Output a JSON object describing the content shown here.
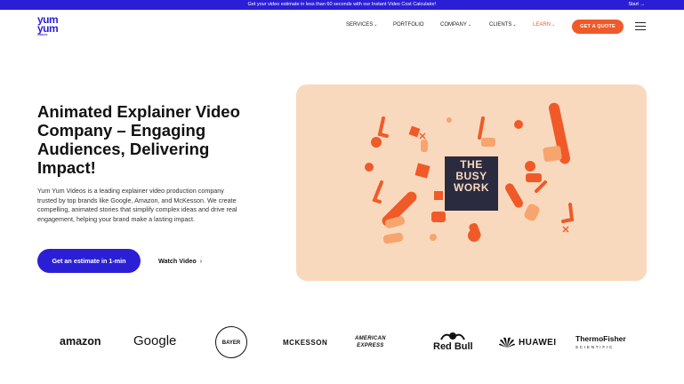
{
  "topbar": {
    "message": "Get your video estimate in less than 60 seconds with our Instant Video Cost Calculator!",
    "start_label": "Start →"
  },
  "header": {
    "logo": {
      "line1": "yum",
      "line2": "yum",
      "tagline": "VIDEOS"
    },
    "nav": [
      {
        "label": "SERVICES",
        "has_dropdown": true
      },
      {
        "label": "PORTFOLIO",
        "has_dropdown": false
      },
      {
        "label": "COMPANY",
        "has_dropdown": true
      },
      {
        "label": "CLIENTS",
        "has_dropdown": true
      },
      {
        "label": "LEARN",
        "has_dropdown": true
      }
    ],
    "quote_button": "GET A QUOTE",
    "menu_icon": "hamburger-menu-icon"
  },
  "hero": {
    "title": "Animated Explainer Video Company – Engaging Audiences, Delivering Impact!",
    "description": "Yum Yum Videos is a leading explainer video production company trusted by top brands like Google, Amazon, and McKesson. We create compelling, animated stories that simplify complex ideas and drive real engagement, helping your brand make a lasting impact.",
    "cta_button": "Get an estimate in 1-min",
    "watch_link": "Watch Video",
    "art": {
      "line1": "THE",
      "line2": "BUSY",
      "line3": "WORK",
      "background_color": "#f9d9bd",
      "accent_color": "#f05a28"
    }
  },
  "clients": {
    "amazon": "amazon",
    "google": "Google",
    "bayer": "BAYER",
    "mckesson": "MCKESSON",
    "amex_line1": "AMERICAN",
    "amex_line2": "EXPRESS",
    "redbull": "Red Bull",
    "huawei": "HUAWEI",
    "thermo_line1": "ThermoFisher",
    "thermo_line2": "SCIENTIFIC"
  },
  "colors": {
    "brand_blue": "#2b1fd6",
    "accent_orange": "#f05a28"
  }
}
